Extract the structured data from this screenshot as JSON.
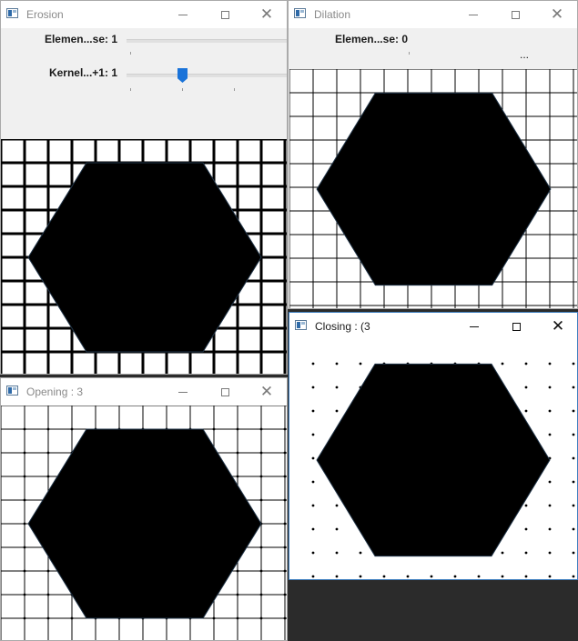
{
  "windows": {
    "erosion": {
      "title": "Erosion",
      "trackbars": [
        {
          "label": "Elemen...se: 1",
          "value": 1
        },
        {
          "label": "Kernel...+1: 1",
          "value": 1
        }
      ],
      "pattern": "thick-grid"
    },
    "dilation": {
      "title": "Dilation",
      "trackbars": [
        {
          "label": "Elemen...se: 0",
          "value": 0
        }
      ],
      "overflow_text": "...",
      "pattern": "thin-grid"
    },
    "opening": {
      "title": "Opening : 3",
      "pattern": "grid-with-dots"
    },
    "closing": {
      "title": "Closing : (3",
      "pattern": "dots"
    }
  },
  "colors": {
    "shape": "#000000",
    "canvas_bg": "#ffffff",
    "trackbar_thumb": "#1a73d9",
    "active_border": "#3f7fbf"
  },
  "icons": {
    "app": "opencv-window-icon",
    "minimize": "minimize-icon",
    "maximize": "maximize-icon",
    "close": "close-icon"
  }
}
